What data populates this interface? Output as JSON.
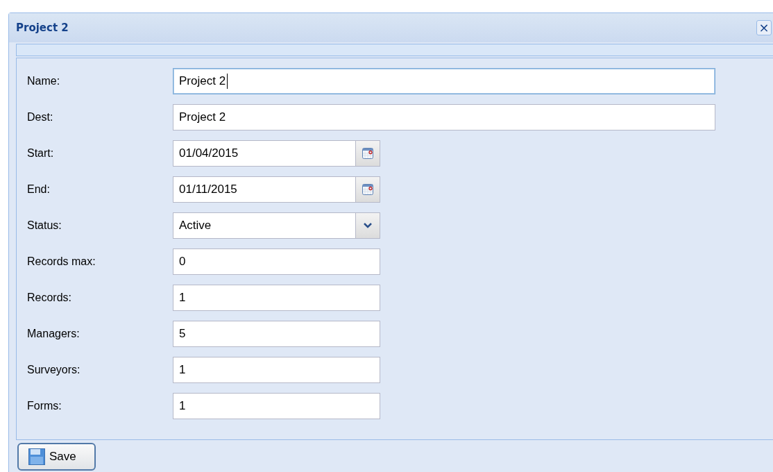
{
  "window": {
    "title": "Project 2",
    "close": "×"
  },
  "fields": [
    {
      "label": "Name:",
      "kind": "longtext",
      "value": "Project 2",
      "focused": true
    },
    {
      "label": "Dest:",
      "kind": "longtext",
      "value": "Project 2",
      "focused": false
    },
    {
      "label": "Start:",
      "kind": "date",
      "value": "01/04/2015",
      "focused": false
    },
    {
      "label": "End:",
      "kind": "date",
      "value": "01/11/2015",
      "focused": false
    },
    {
      "label": "Status:",
      "kind": "select",
      "value": "Active",
      "focused": false
    },
    {
      "label": "Records max:",
      "kind": "text",
      "value": "0",
      "focused": false
    },
    {
      "label": "Records:",
      "kind": "text",
      "value": "1",
      "focused": false
    },
    {
      "label": "Managers:",
      "kind": "text",
      "value": "5",
      "focused": false
    },
    {
      "label": "Surveyors:",
      "kind": "text",
      "value": "1",
      "focused": false
    },
    {
      "label": "Forms:",
      "kind": "text",
      "value": "1",
      "focused": false
    }
  ],
  "buttons": [
    {
      "label": "Save"
    }
  ]
}
